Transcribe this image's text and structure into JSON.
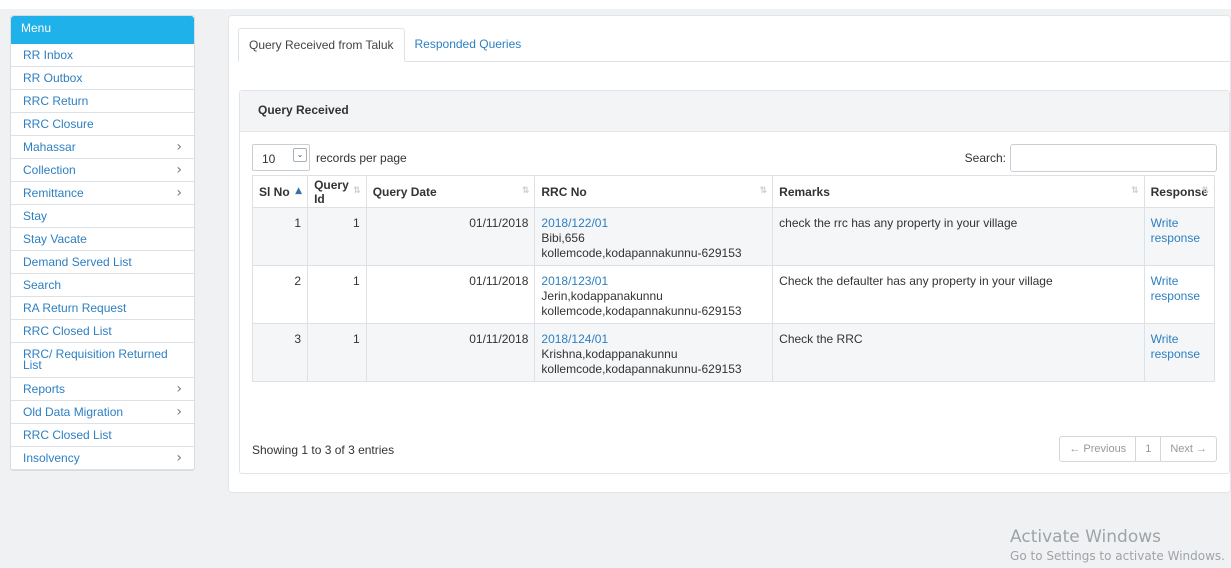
{
  "sidebar": {
    "header": "Menu",
    "items": [
      {
        "label": "RR Inbox",
        "chevron": false
      },
      {
        "label": "RR Outbox",
        "chevron": false
      },
      {
        "label": "RRC Return",
        "chevron": false
      },
      {
        "label": "RRC Closure",
        "chevron": false
      },
      {
        "label": "Mahassar",
        "chevron": true
      },
      {
        "label": "Collection",
        "chevron": true
      },
      {
        "label": "Remittance",
        "chevron": true
      },
      {
        "label": "Stay",
        "chevron": false
      },
      {
        "label": "Stay Vacate",
        "chevron": false
      },
      {
        "label": "Demand Served List",
        "chevron": false
      },
      {
        "label": "Search",
        "chevron": false
      },
      {
        "label": "RA Return Request",
        "chevron": false
      },
      {
        "label": "RRC Closed List",
        "chevron": false
      },
      {
        "label": "RRC/ Requisition Returned List",
        "chevron": false
      },
      {
        "label": "Reports",
        "chevron": true
      },
      {
        "label": "Old Data Migration",
        "chevron": true
      },
      {
        "label": "RRC Closed List",
        "chevron": false
      },
      {
        "label": "Insolvency",
        "chevron": true
      }
    ],
    "chevron_glyph": "›"
  },
  "tabs": [
    {
      "label": "Query Received from Taluk",
      "active": true
    },
    {
      "label": "Responded Queries",
      "active": false
    }
  ],
  "panel": {
    "title": "Query Received",
    "length_value": "10",
    "length_arrow": "⌄",
    "length_suffix": "records per page",
    "search_label": "Search:",
    "search_value": ""
  },
  "table": {
    "columns": [
      "Sl No",
      "Query Id",
      "Query Date",
      "RRC No",
      "Remarks",
      "Response"
    ],
    "sort_on": "▲",
    "sort_off": "⇅",
    "rows": [
      {
        "sl": "1",
        "qid": "1",
        "date": "01/11/2018",
        "rrc_link": "2018/122/01",
        "rrc_line1": "Bibi,656",
        "rrc_line2": "kollemcode,kodapannakunnu-629153",
        "remarks": "check the rrc has any property in your village",
        "response": "Write response"
      },
      {
        "sl": "2",
        "qid": "1",
        "date": "01/11/2018",
        "rrc_link": "2018/123/01",
        "rrc_line1": "Jerin,kodappanakunnu",
        "rrc_line2": "kollemcode,kodapannakunnu-629153",
        "remarks": "Check the defaulter has any property in your village",
        "response": "Write response"
      },
      {
        "sl": "3",
        "qid": "1",
        "date": "01/11/2018",
        "rrc_link": "2018/124/01",
        "rrc_line1": "Krishna,kodappanakunnu",
        "rrc_line2": "kollemcode,kodapannakunnu-629153",
        "remarks": "Check the RRC",
        "response": "Write response"
      }
    ]
  },
  "footer": {
    "info": "Showing 1 to 3 of 3 entries",
    "prev": "← Previous",
    "page": "1",
    "next": "Next →"
  },
  "watermark": {
    "line1": "Activate Windows",
    "line2": "Go to Settings to activate Windows."
  },
  "colors": {
    "accent": "#1fb1ea",
    "link": "#2d7fc1"
  }
}
